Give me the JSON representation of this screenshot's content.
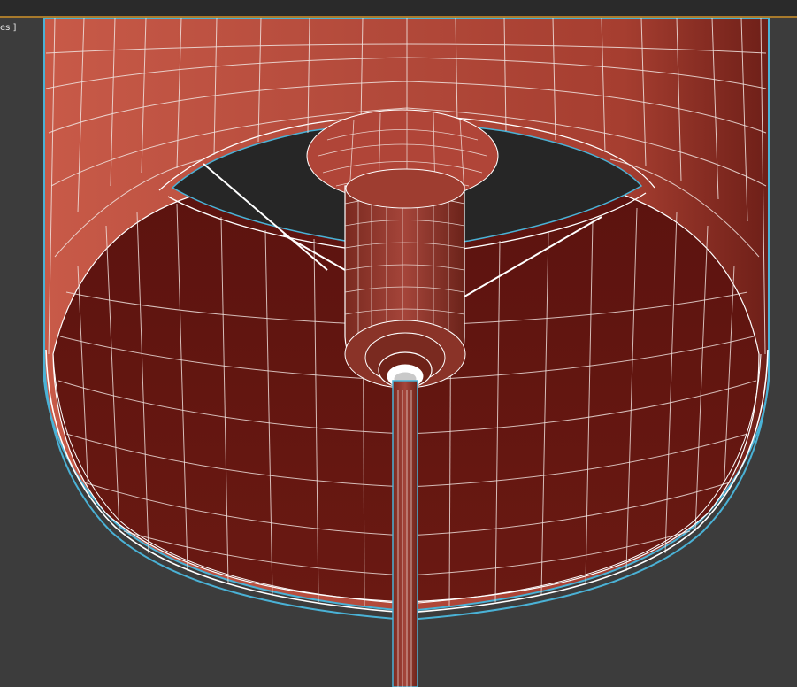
{
  "viewport": {
    "label_text": "es ]",
    "active_border_color": "#4ab2d6",
    "background_color": "#3c3c3c"
  },
  "scene": {
    "object": "lamp-shade-wireframe",
    "shade_color_outer": "#b4473a",
    "shade_color_inner": "#5e1510",
    "wire_color": "#ffffff",
    "selection_color": "#4ab2d6"
  },
  "titlebar": {
    "accent_color": "#a87a2c"
  }
}
